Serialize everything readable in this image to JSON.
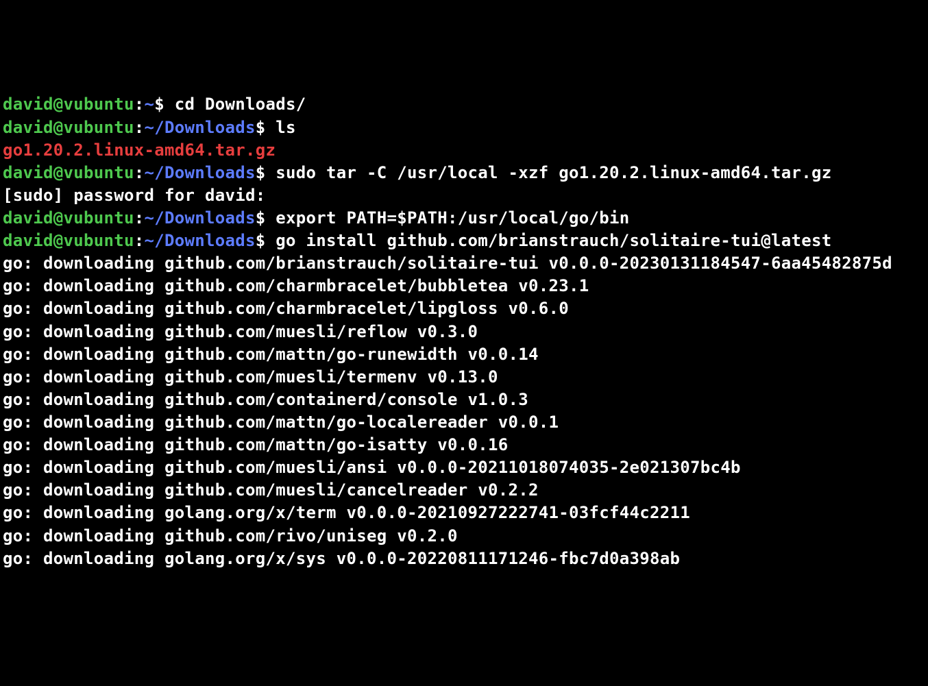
{
  "prompts": [
    {
      "user": "david@vubuntu",
      "path": "~",
      "cmd": "cd Downloads/"
    },
    {
      "user": "david@vubuntu",
      "path": "~/Downloads",
      "cmd": "ls"
    }
  ],
  "file_listing": "go1.20.2.linux-amd64.tar.gz",
  "prompt3": {
    "user": "david@vubuntu",
    "path": "~/Downloads",
    "cmd": "sudo tar -C /usr/local -xzf go1.20.2.linux-amd64.tar.gz"
  },
  "sudo_line": "[sudo] password for david:",
  "prompt4": {
    "user": "david@vubuntu",
    "path": "~/Downloads",
    "cmd": "export PATH=$PATH:/usr/local/go/bin"
  },
  "prompt5": {
    "user": "david@vubuntu",
    "path": "~/Downloads",
    "cmd": "go install github.com/brianstrauch/solitaire-tui@latest"
  },
  "downloads": [
    "go: downloading github.com/brianstrauch/solitaire-tui v0.0.0-20230131184547-6aa45482875d",
    "go: downloading github.com/charmbracelet/bubbletea v0.23.1",
    "go: downloading github.com/charmbracelet/lipgloss v0.6.0",
    "go: downloading github.com/muesli/reflow v0.3.0",
    "go: downloading github.com/mattn/go-runewidth v0.0.14",
    "go: downloading github.com/muesli/termenv v0.13.0",
    "go: downloading github.com/containerd/console v1.0.3",
    "go: downloading github.com/mattn/go-localereader v0.0.1",
    "go: downloading github.com/mattn/go-isatty v0.0.16",
    "go: downloading github.com/muesli/ansi v0.0.0-20211018074035-2e021307bc4b",
    "go: downloading github.com/muesli/cancelreader v0.2.2",
    "go: downloading golang.org/x/term v0.0.0-20210927222741-03fcf44c2211",
    "go: downloading github.com/rivo/uniseg v0.2.0",
    "go: downloading golang.org/x/sys v0.0.0-20220811171246-fbc7d0a398ab"
  ]
}
